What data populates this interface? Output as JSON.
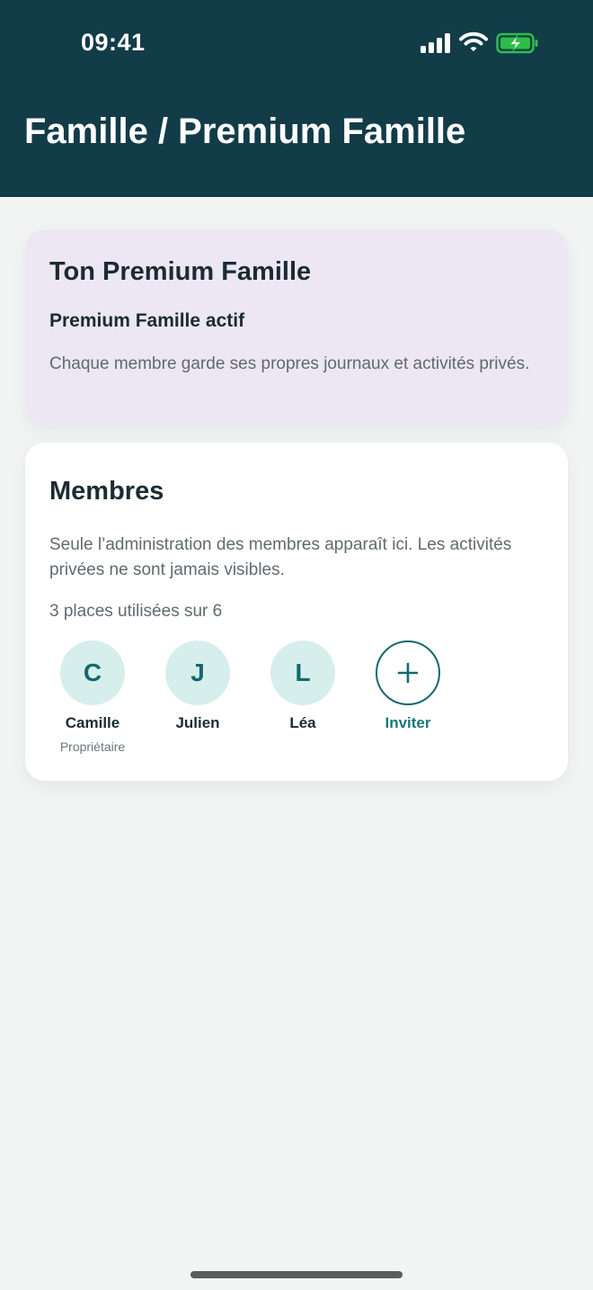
{
  "status_bar": {
    "time": "09:41",
    "icons": [
      "signal-icon",
      "wifi-icon",
      "battery-charging-icon"
    ],
    "battery_color": "#2fbd4a"
  },
  "header": {
    "title": "Famille / Premium Famille",
    "background": "#113c48"
  },
  "premium_card": {
    "title": "Ton Premium Famille",
    "status": "Premium Famille actif",
    "description": "Chaque membre garde ses propres journaux et activités privés.",
    "background": "#ede6f4"
  },
  "members_card": {
    "title": "Membres",
    "description": "Seule l’administration des membres apparaît ici. Les activités privées ne sont jamais visibles.",
    "seats_text": "3 places utilisées sur 6",
    "seats_used": 3,
    "seats_total": 6,
    "members": [
      {
        "initial": "C",
        "name": "Camille",
        "role": "Propriétaire"
      },
      {
        "initial": "J",
        "name": "Julien",
        "role": ""
      },
      {
        "initial": "L",
        "name": "Léa",
        "role": ""
      }
    ],
    "invite": {
      "icon": "plus-icon",
      "label": "Inviter"
    },
    "accent": "#15696d"
  }
}
